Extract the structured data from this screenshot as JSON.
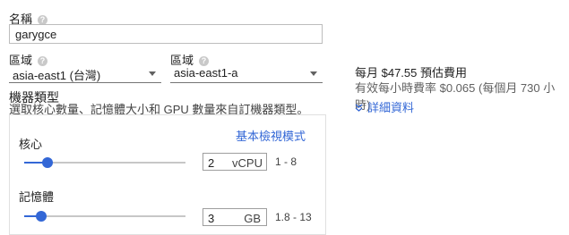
{
  "name": {
    "label": "名稱",
    "value": "garygce"
  },
  "region": {
    "label": "區域",
    "value": "asia-east1 (台灣)"
  },
  "zone": {
    "label": "區域",
    "value": "asia-east1-a"
  },
  "help_glyph": "?",
  "machine_type": {
    "title": "機器類型",
    "description": "選取核心數量、記憶體大小和 GPU 數量來自訂機器類型。",
    "basic_view_link": "基本檢視模式",
    "cores": {
      "label": "核心",
      "value": "2",
      "unit": "vCPU",
      "range": "1 - 8",
      "slider_fraction": 0.143
    },
    "memory": {
      "label": "記憶體",
      "value": "3",
      "unit": "GB",
      "range": "1.8 - 13",
      "slider_fraction": 0.106
    }
  },
  "pricing": {
    "monthly": "每月 $47.55 預估費用",
    "hourly": "有效每小時費率 $0.065 (每個月 730 小時)",
    "details_link": "詳細資料",
    "details_icon": "chevron-double-down-icon"
  },
  "colors": {
    "accent": "#3367d6",
    "track": "#c7c7c7"
  }
}
